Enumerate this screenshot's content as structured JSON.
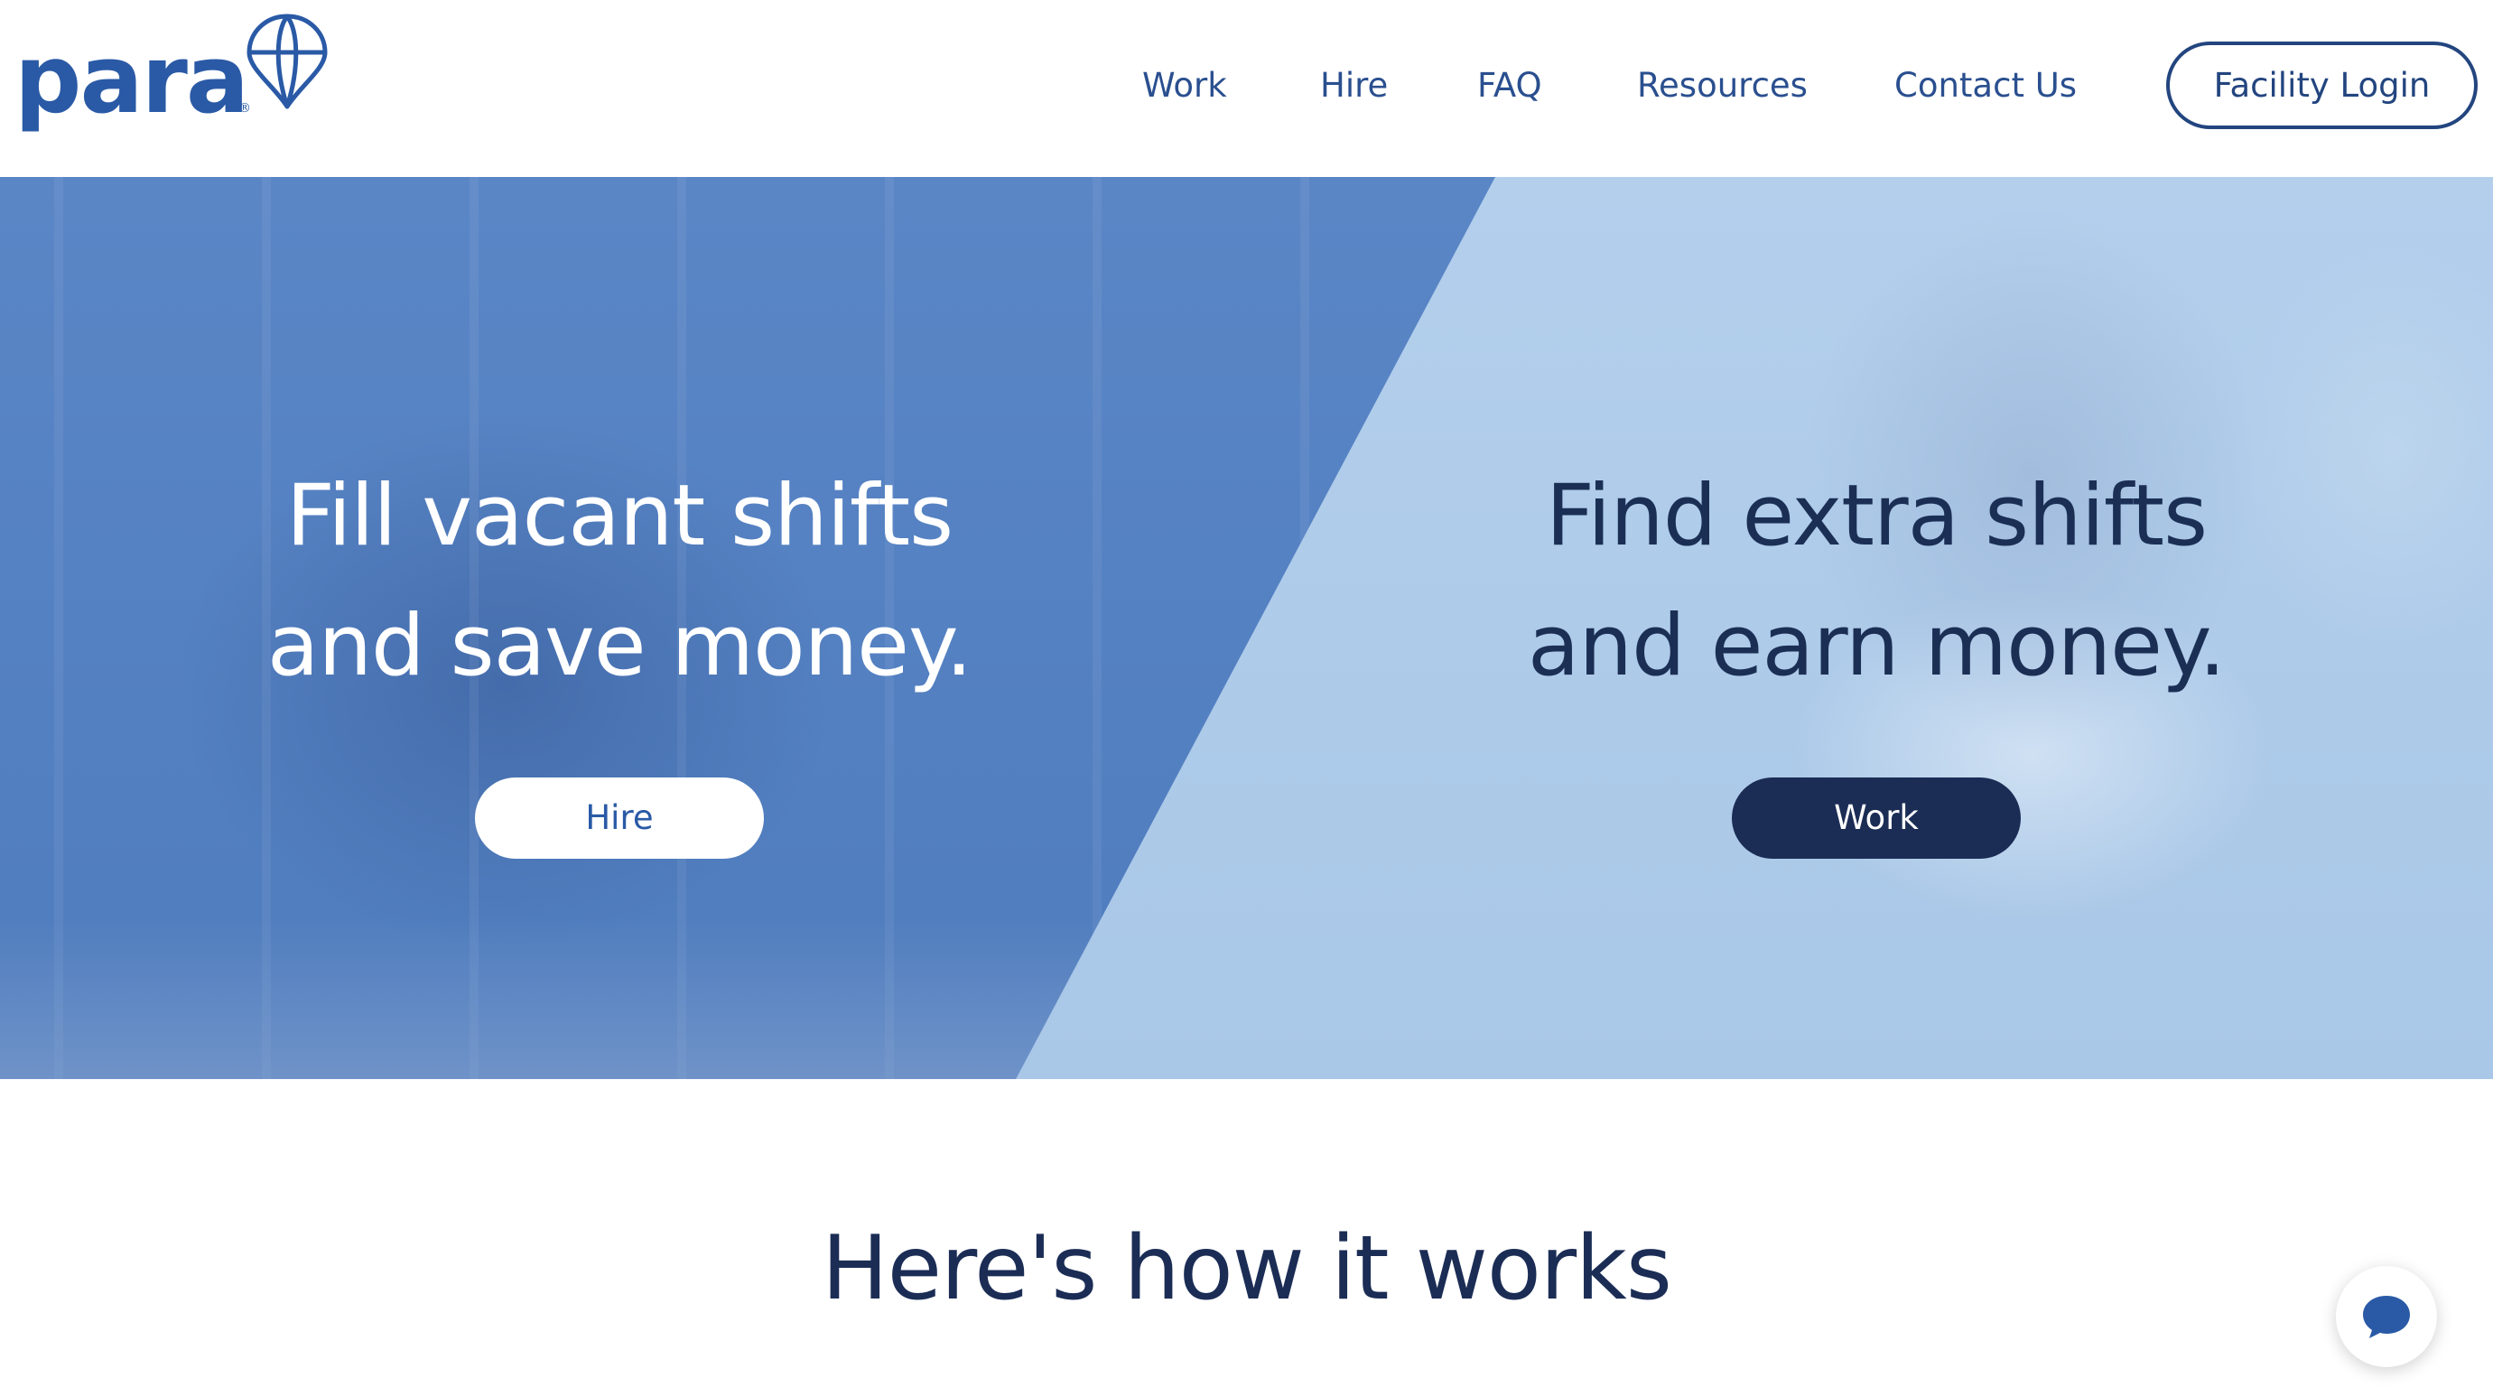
{
  "header": {
    "logo_text": "para",
    "logo_mark": "®",
    "nav": [
      {
        "label": "Work"
      },
      {
        "label": "Hire"
      },
      {
        "label": "FAQ"
      },
      {
        "label": "Resources"
      },
      {
        "label": "Contact Us"
      }
    ],
    "login_label": "Facility Login"
  },
  "hero": {
    "left": {
      "line1": "Fill vacant shifts",
      "line2": "and save money.",
      "button": "Hire"
    },
    "right": {
      "line1": "Find extra shifts",
      "line2": "and earn money.",
      "button": "Work"
    }
  },
  "how": {
    "title": "Here's how it works"
  },
  "icons": {
    "logo": "hot-air-balloon-icon",
    "chat": "chat-bubble-icon"
  },
  "colors": {
    "brand_blue": "#2a5aa6",
    "navy": "#1b2d55",
    "hero_left": "#5380c1",
    "hero_right": "#adcbea"
  }
}
